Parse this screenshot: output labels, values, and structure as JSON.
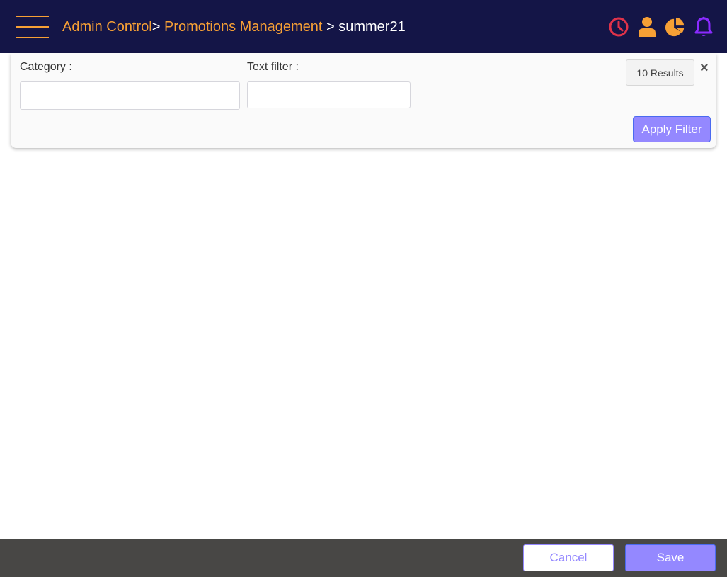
{
  "header": {
    "breadcrumb": [
      {
        "label": "Admin Control",
        "type": "link"
      },
      {
        "label": "Promotions Management",
        "type": "link"
      },
      {
        "label": "summer21",
        "type": "current"
      }
    ],
    "separator": ">",
    "icons": [
      {
        "name": "clock-icon",
        "color": "#e0334a"
      },
      {
        "name": "user-icon",
        "color": "#f7a035"
      },
      {
        "name": "pie-chart-icon",
        "color": "#f7a035"
      },
      {
        "name": "bell-icon",
        "color": "#8a2bff"
      }
    ]
  },
  "filter": {
    "category_label": "Category :",
    "category_value": "",
    "text_filter_label": "Text filter :",
    "text_filter_value": "",
    "results": "10 Results",
    "close": "×",
    "apply_label": "Apply Filter"
  },
  "footer": {
    "cancel_label": "Cancel",
    "save_label": "Save"
  },
  "colors": {
    "topbar": "#141547",
    "accent": "#f7a035",
    "primary": "#9488ff",
    "footer": "#484745"
  }
}
